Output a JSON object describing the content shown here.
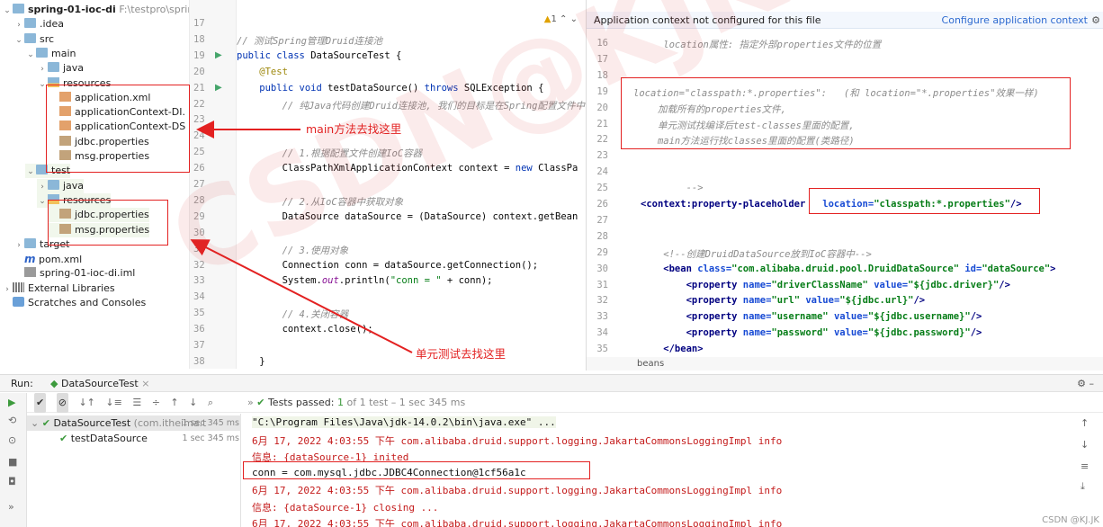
{
  "project_tree": [
    {
      "label": "spring-01-ioc-di",
      "extra": "F:\\testpro\\spring-",
      "indent": 0,
      "arrow": "down",
      "icon": "module-folder-icon",
      "bold": true
    },
    {
      "label": ".idea",
      "indent": 1,
      "arrow": "right",
      "icon": "folder-icon"
    },
    {
      "label": "src",
      "indent": 1,
      "arrow": "down",
      "icon": "folder-icon"
    },
    {
      "label": "main",
      "indent": 2,
      "arrow": "down",
      "icon": "folder-icon"
    },
    {
      "label": "java",
      "indent": 3,
      "arrow": "right",
      "icon": "folder-icon"
    },
    {
      "label": "resources",
      "indent": 3,
      "arrow": "down",
      "icon": "resources-folder-icon"
    },
    {
      "label": "application.xml",
      "indent": 4,
      "icon": "xml-file-icon"
    },
    {
      "label": "applicationContext-DI.",
      "indent": 4,
      "icon": "xml-file-icon"
    },
    {
      "label": "applicationContext-DS",
      "indent": 4,
      "icon": "xml-file-icon"
    },
    {
      "label": "jdbc.properties",
      "indent": 4,
      "icon": "properties-file-icon"
    },
    {
      "label": "msg.properties",
      "indent": 4,
      "icon": "properties-file-icon"
    },
    {
      "label": "test",
      "indent": 2,
      "arrow": "down",
      "icon": "folder-icon"
    },
    {
      "label": "java",
      "indent": 3,
      "arrow": "right",
      "icon": "folder-icon"
    },
    {
      "label": "resources",
      "indent": 3,
      "arrow": "down",
      "icon": "resources-folder-icon"
    },
    {
      "label": "jdbc.properties",
      "indent": 4,
      "icon": "properties-file-icon"
    },
    {
      "label": "msg.properties",
      "indent": 4,
      "icon": "properties-file-icon"
    },
    {
      "label": "target",
      "indent": 1,
      "arrow": "right",
      "icon": "folder-icon"
    },
    {
      "label": "pom.xml",
      "indent": 1,
      "icon": "maven-file-icon"
    },
    {
      "label": "spring-01-ioc-di.iml",
      "indent": 1,
      "icon": "iml-file-icon"
    },
    {
      "label": "External Libraries",
      "indent": 0,
      "arrow": "right",
      "icon": "libraries-icon"
    },
    {
      "label": "Scratches and Consoles",
      "indent": 0,
      "icon": "scratches-icon"
    }
  ],
  "editor": {
    "warning_count": "1",
    "line_numbers": [
      "17",
      "18",
      "19",
      "20",
      "21",
      "22",
      "23",
      "24",
      "25",
      "26",
      "27",
      "28",
      "29",
      "30",
      "31",
      "32",
      "33",
      "34",
      "35",
      "36",
      "37",
      "38"
    ],
    "lines": [
      [],
      [
        {
          "t": "// 测试Spring管理Druid连接池",
          "c": "cm"
        }
      ],
      [
        {
          "t": "public class ",
          "c": "kw"
        },
        {
          "t": "DataSourceTest {",
          "c": ""
        }
      ],
      [
        {
          "t": "    @Test",
          "c": "ann"
        }
      ],
      [
        {
          "t": "    public void ",
          "c": "kw"
        },
        {
          "t": "testDataSource() ",
          "c": ""
        },
        {
          "t": "throws ",
          "c": "kw"
        },
        {
          "t": "SQLException {",
          "c": ""
        }
      ],
      [
        {
          "t": "        // 纯Java代码创建Druid连接池, 我们的目标是在Spring配置文件中",
          "c": "cm"
        }
      ],
      [],
      [],
      [
        {
          "t": "        // 1.根据配置文件创建IoC容器",
          "c": "cm"
        }
      ],
      [
        {
          "t": "        ClassPathXmlApplicationContext context = ",
          "c": ""
        },
        {
          "t": "new ",
          "c": "kw"
        },
        {
          "t": "ClassPa",
          "c": ""
        }
      ],
      [],
      [
        {
          "t": "        // 2.从IoC容器中获取对象",
          "c": "cm"
        }
      ],
      [
        {
          "t": "        DataSource dataSource = (DataSource) context.getBean",
          "c": ""
        }
      ],
      [],
      [
        {
          "t": "        // 3.使用对象",
          "c": "cm"
        }
      ],
      [
        {
          "t": "        Connection conn = dataSource.getConnection();",
          "c": ""
        }
      ],
      [
        {
          "t": "        System.",
          "c": ""
        },
        {
          "t": "out",
          "c": "fld"
        },
        {
          "t": ".println(",
          "c": ""
        },
        {
          "t": "\"conn = \"",
          "c": "str"
        },
        {
          "t": " + conn);",
          "c": ""
        }
      ],
      [],
      [
        {
          "t": "        // 4.关闭容器",
          "c": "cm"
        }
      ],
      [
        {
          "t": "        context.close();",
          "c": ""
        }
      ],
      [],
      [
        {
          "t": "    }",
          "c": ""
        }
      ]
    ]
  },
  "xml_pane": {
    "banner_text": "Application context not configured for this file",
    "banner_link": "Configure application context",
    "line_numbers": [
      "16",
      "17",
      "18",
      "19",
      "20",
      "21",
      "22",
      "23",
      "24",
      "25",
      "26",
      "27",
      "28",
      "29",
      "30",
      "31",
      "32",
      "33",
      "34",
      "35"
    ],
    "lines": [
      [
        {
          "t": "    location属性: 指定外部properties文件的位置",
          "c": "xcm"
        }
      ],
      [],
      [],
      [
        {
          "t": "location=\"classpath:*.properties\":   (和 location=\"*.properties\"效果一样)",
          "c": "xcm"
        }
      ],
      [
        {
          "t": "   加载所有的properties文件,",
          "c": "xcm"
        }
      ],
      [
        {
          "t": "   单元测试找编译后test-classes里面的配置,",
          "c": "xcm"
        }
      ],
      [
        {
          "t": "   main方法运行找classes里面的配置(类路径)",
          "c": "xcm"
        }
      ],
      [],
      [],
      [
        {
          "t": "        -->",
          "c": "xcm"
        }
      ],
      [
        {
          "t": "<context:property-placeholder",
          "c": "tagline"
        },
        {
          "t": "   location=",
          "c": "attr"
        },
        {
          "t": "\"classpath:*.properties\"",
          "c": "aval"
        },
        {
          "t": "/>",
          "c": "tagline"
        }
      ],
      [],
      [],
      [
        {
          "t": "    <!--创建DruidDataSource放到IoC容器中-->",
          "c": "xcm"
        }
      ],
      [
        {
          "t": "    <bean ",
          "c": "tagline"
        },
        {
          "t": "class=",
          "c": "attr"
        },
        {
          "t": "\"com.alibaba.druid.pool.DruidDataSource\" ",
          "c": "aval"
        },
        {
          "t": "id=",
          "c": "attr"
        },
        {
          "t": "\"dataSource\"",
          "c": "aval"
        },
        {
          "t": ">",
          "c": "tagline"
        }
      ],
      [
        {
          "t": "        <property ",
          "c": "tagline"
        },
        {
          "t": "name=",
          "c": "attr"
        },
        {
          "t": "\"driverClassName\" ",
          "c": "aval"
        },
        {
          "t": "value=",
          "c": "attr"
        },
        {
          "t": "\"${jdbc.driver}\"",
          "c": "aval"
        },
        {
          "t": "/>",
          "c": "tagline"
        }
      ],
      [
        {
          "t": "        <property ",
          "c": "tagline"
        },
        {
          "t": "name=",
          "c": "attr"
        },
        {
          "t": "\"url\" ",
          "c": "aval"
        },
        {
          "t": "value=",
          "c": "attr"
        },
        {
          "t": "\"${jdbc.url}\"",
          "c": "aval"
        },
        {
          "t": "/>",
          "c": "tagline"
        }
      ],
      [
        {
          "t": "        <property ",
          "c": "tagline"
        },
        {
          "t": "name=",
          "c": "attr"
        },
        {
          "t": "\"username\" ",
          "c": "aval"
        },
        {
          "t": "value=",
          "c": "attr"
        },
        {
          "t": "\"${jdbc.username}\"",
          "c": "aval"
        },
        {
          "t": "/>",
          "c": "tagline"
        }
      ],
      [
        {
          "t": "        <property ",
          "c": "tagline"
        },
        {
          "t": "name=",
          "c": "attr"
        },
        {
          "t": "\"password\" ",
          "c": "aval"
        },
        {
          "t": "value=",
          "c": "attr"
        },
        {
          "t": "\"${jdbc.password}\"",
          "c": "aval"
        },
        {
          "t": "/>",
          "c": "tagline"
        }
      ],
      [
        {
          "t": "    </bean>",
          "c": "tagline"
        }
      ]
    ],
    "footer": "beans"
  },
  "run": {
    "label": "Run:",
    "tab": "DataSourceTest",
    "tests_passed": "Tests passed:",
    "tests_count": "1",
    "tests_detail": "of 1 test – 1 sec 345 ms",
    "tree": [
      {
        "name": "DataSourceTest",
        "pkg": "(com.itheima.t",
        "time": "1 sec 345 ms"
      },
      {
        "name": "testDataSource",
        "time": "1 sec 345 ms"
      }
    ],
    "console": [
      {
        "t": "\"C:\\Program Files\\Java\\jdk-14.0.2\\bin\\java.exe\" ...",
        "c": "cmd"
      },
      {
        "t": "6月 17, 2022 4:03:55 下午 com.alibaba.druid.support.logging.JakartaCommonsLoggingImpl info",
        "c": "cerr"
      },
      {
        "t": "信息: {dataSource-1} inited",
        "c": "cerr"
      },
      {
        "t": "conn = com.mysql.jdbc.JDBC4Connection@1cf56a1c",
        "c": "cnorm"
      },
      {
        "t": "6月 17, 2022 4:03:55 下午 com.alibaba.druid.support.logging.JakartaCommonsLoggingImpl info",
        "c": "cerr"
      },
      {
        "t": "信息: {dataSource-1} closing ...",
        "c": "cerr"
      },
      {
        "t": "6月 17, 2022 4:03:55 下午 com.alibaba.druid.support.logging.JakartaCommonsLoggingImpl info",
        "c": "cerr"
      }
    ]
  },
  "annotations": {
    "main_note": "main方法去找这里",
    "test_note": "单元测试去找这里"
  },
  "watermark": "CSDN@KJK",
  "credit": "CSDN @KJ.JK"
}
